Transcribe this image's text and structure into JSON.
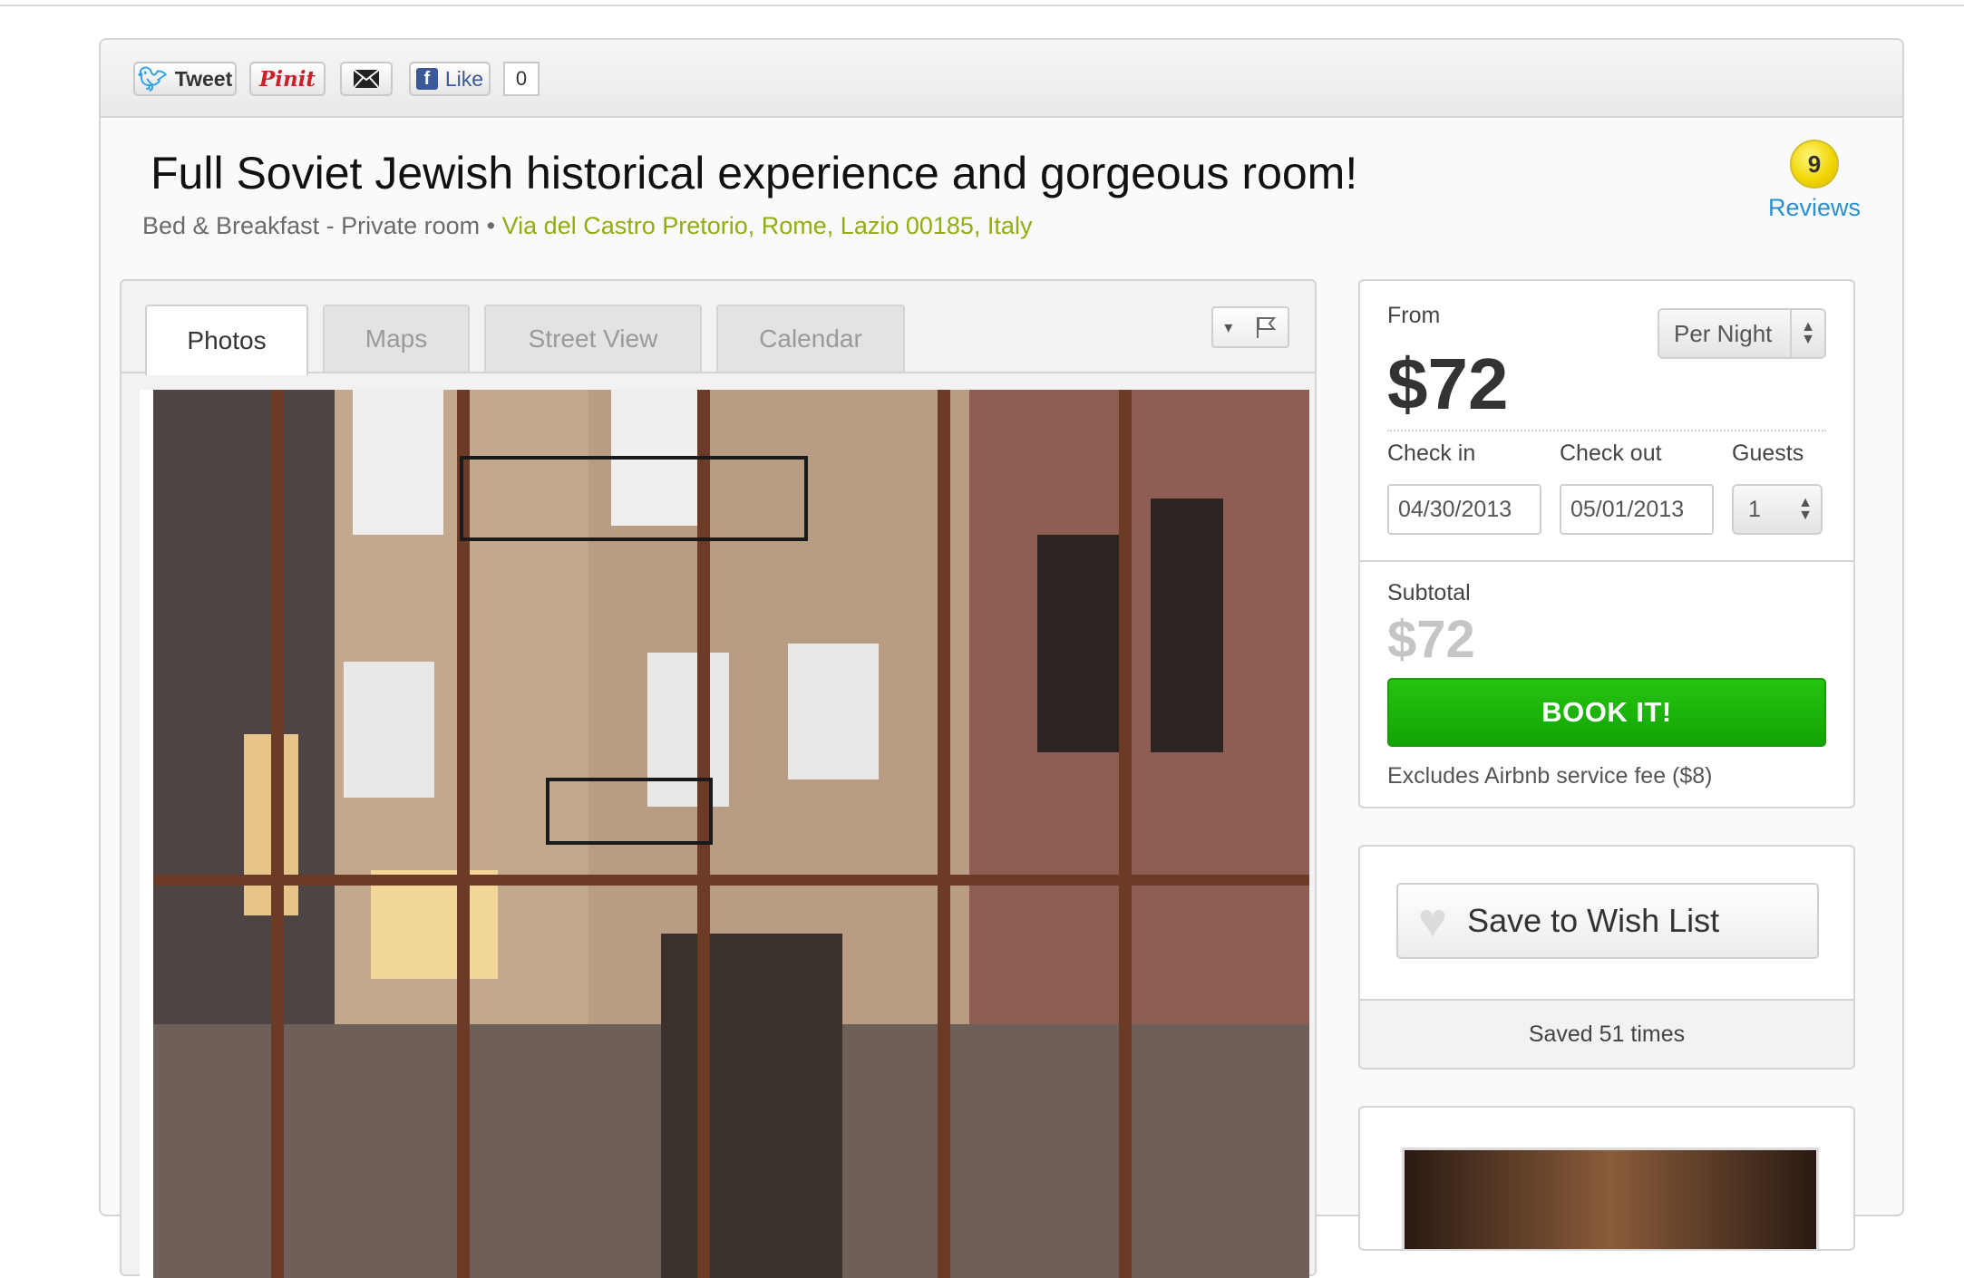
{
  "share": {
    "tweet_label": "Tweet",
    "pin_label": "Pinit",
    "like_label": "Like",
    "like_count": "0"
  },
  "listing": {
    "title": "Full Soviet Jewish historical experience and gorgeous room!",
    "type": "Bed & Breakfast - Private room",
    "separator": "•",
    "address": "Via del Castro Pretorio, Rome, Lazio 00185, Italy",
    "reviews_count": "9",
    "reviews_label": "Reviews"
  },
  "tabs": [
    "Photos",
    "Maps",
    "Street View",
    "Calendar"
  ],
  "active_tab": "Photos",
  "booking": {
    "from_label": "From",
    "price": "$72",
    "period": "Per Night",
    "checkin_label": "Check in",
    "checkout_label": "Check out",
    "guests_label": "Guests",
    "checkin_value": "04/30/2013",
    "checkout_value": "05/01/2013",
    "guests_value": "1",
    "subtotal_label": "Subtotal",
    "subtotal_value": "$72",
    "book_label": "BOOK IT!",
    "fee_note": "Excludes Airbnb service fee ($8)"
  },
  "wishlist": {
    "button_label": "Save to Wish List",
    "saved_text": "Saved 51 times"
  },
  "colors": {
    "accent_green": "#12a303",
    "link_blue": "#2a8fd0",
    "address_green": "#8fae10"
  },
  "icons": [
    "twitter-bird-icon",
    "envelope-icon",
    "facebook-icon",
    "caret-down-icon",
    "flag-icon",
    "heart-icon",
    "select-arrows-icon"
  ]
}
